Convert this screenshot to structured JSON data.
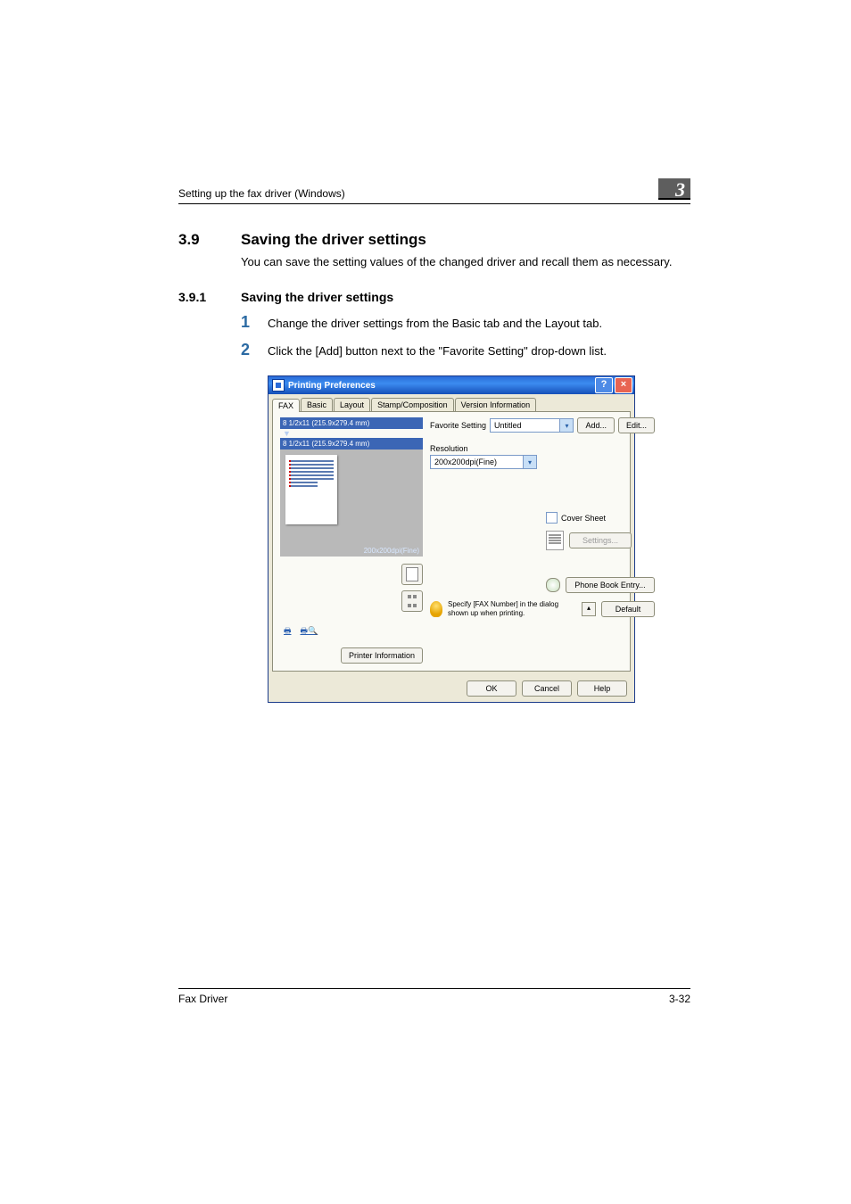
{
  "header": {
    "breadcrumb": "Setting up the fax driver (Windows)",
    "chapter": "3"
  },
  "section": {
    "number": "3.9",
    "title": "Saving the driver settings"
  },
  "section_body": "You can save the setting values of the changed driver and recall them as necessary.",
  "subsection": {
    "number": "3.9.1",
    "title": "Saving the driver settings"
  },
  "steps": [
    {
      "num": "1",
      "text": "Change the driver settings from the Basic tab and the Layout tab."
    },
    {
      "num": "2",
      "text": "Click the [Add] button next to the \"Favorite Setting\" drop-down list."
    }
  ],
  "dialog": {
    "title": "Printing Preferences",
    "help_btn": "?",
    "close_btn": "×",
    "tabs": [
      "FAX",
      "Basic",
      "Layout",
      "Stamp/Composition",
      "Version Information"
    ],
    "active_tab": 0,
    "preview": {
      "orig_label": "8 1/2x11 (215.9x279.4 mm)",
      "out_label": "8 1/2x11 (215.9x279.4 mm)",
      "mode_text": "200x200dpi(Fine)"
    },
    "printer_info_btn": "Printer Information",
    "favorite": {
      "label": "Favorite Setting",
      "value": "Untitled",
      "add_btn": "Add...",
      "edit_btn": "Edit..."
    },
    "resolution": {
      "label": "Resolution",
      "value": "200x200dpi(Fine)"
    },
    "cover": {
      "checkbox": "Cover Sheet",
      "settings_btn": "Settings..."
    },
    "phonebook_btn": "Phone Book Entry...",
    "hint": "Specify [FAX Number] in the dialog shown up when printing.",
    "default_btn": "Default",
    "ok_btn": "OK",
    "cancel_btn": "Cancel",
    "help_footer_btn": "Help"
  },
  "footer": {
    "left": "Fax Driver",
    "right": "3-32"
  }
}
